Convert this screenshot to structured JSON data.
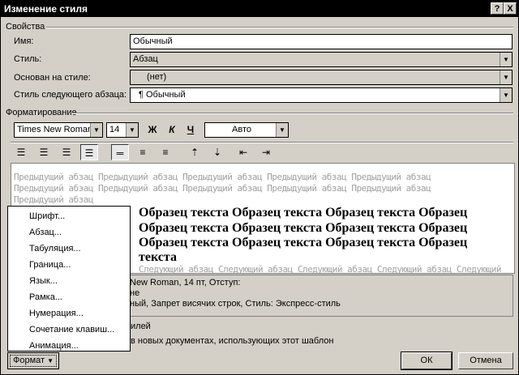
{
  "title": "Изменение стиля",
  "title_buttons": {
    "help": "?",
    "close": "X"
  },
  "properties": {
    "group_label": "Свойства",
    "name_label": "Имя:",
    "name_value": "Обычный",
    "style_label": "Стиль:",
    "style_value": "Абзац",
    "based_on_label": "Основан на стиле:",
    "based_on_value": "(нет)",
    "next_style_label": "Стиль следующего абзаца:",
    "next_style_value": "¶ Обычный"
  },
  "formatting": {
    "group_label": "Форматирование",
    "font_name": "Times New Roman",
    "font_size": "14",
    "bold_label": "Ж",
    "italic_label": "К",
    "underline_label": "Ч",
    "color_value": "Авто"
  },
  "preview": {
    "prev_lines": [
      "Предыдущий абзац Предыдущий абзац Предыдущий абзац Предыдущий абзац Предыдущий абзац",
      "Предыдущий абзац Предыдущий абзац Предыдущий абзац Предыдущий абзац Предыдущий абзац",
      "Предыдущий абзац"
    ],
    "sample_lines": [
      "Образец текста Образец текста Образец текста Образец",
      "Образец текста Образец текста Образец текста Образец",
      "Образец текста Образец текста Образец текста Образец",
      "текста"
    ],
    "next_line": "Следующий абзац Следующий абзац Следующий абзац Следующий абзац Следующий"
  },
  "description": {
    "line1": "New Roman, 14 пт, Отступ:",
    "line2": "не",
    "line3": "ный, Запрет висячих строк, Стиль: Экспресс-стиль"
  },
  "options": {
    "add_to_list_fragment": "илей",
    "only_doc_fragment": "в новых документах, использующих этот шаблон"
  },
  "format_menu": [
    "Шрифт...",
    "Абзац...",
    "Табуляция...",
    "Граница...",
    "Язык...",
    "Рамка...",
    "Нумерация...",
    "Сочетание клавиш...",
    "Анимация..."
  ],
  "buttons": {
    "format": "Формат",
    "ok": "ОК",
    "cancel": "Отмена"
  }
}
